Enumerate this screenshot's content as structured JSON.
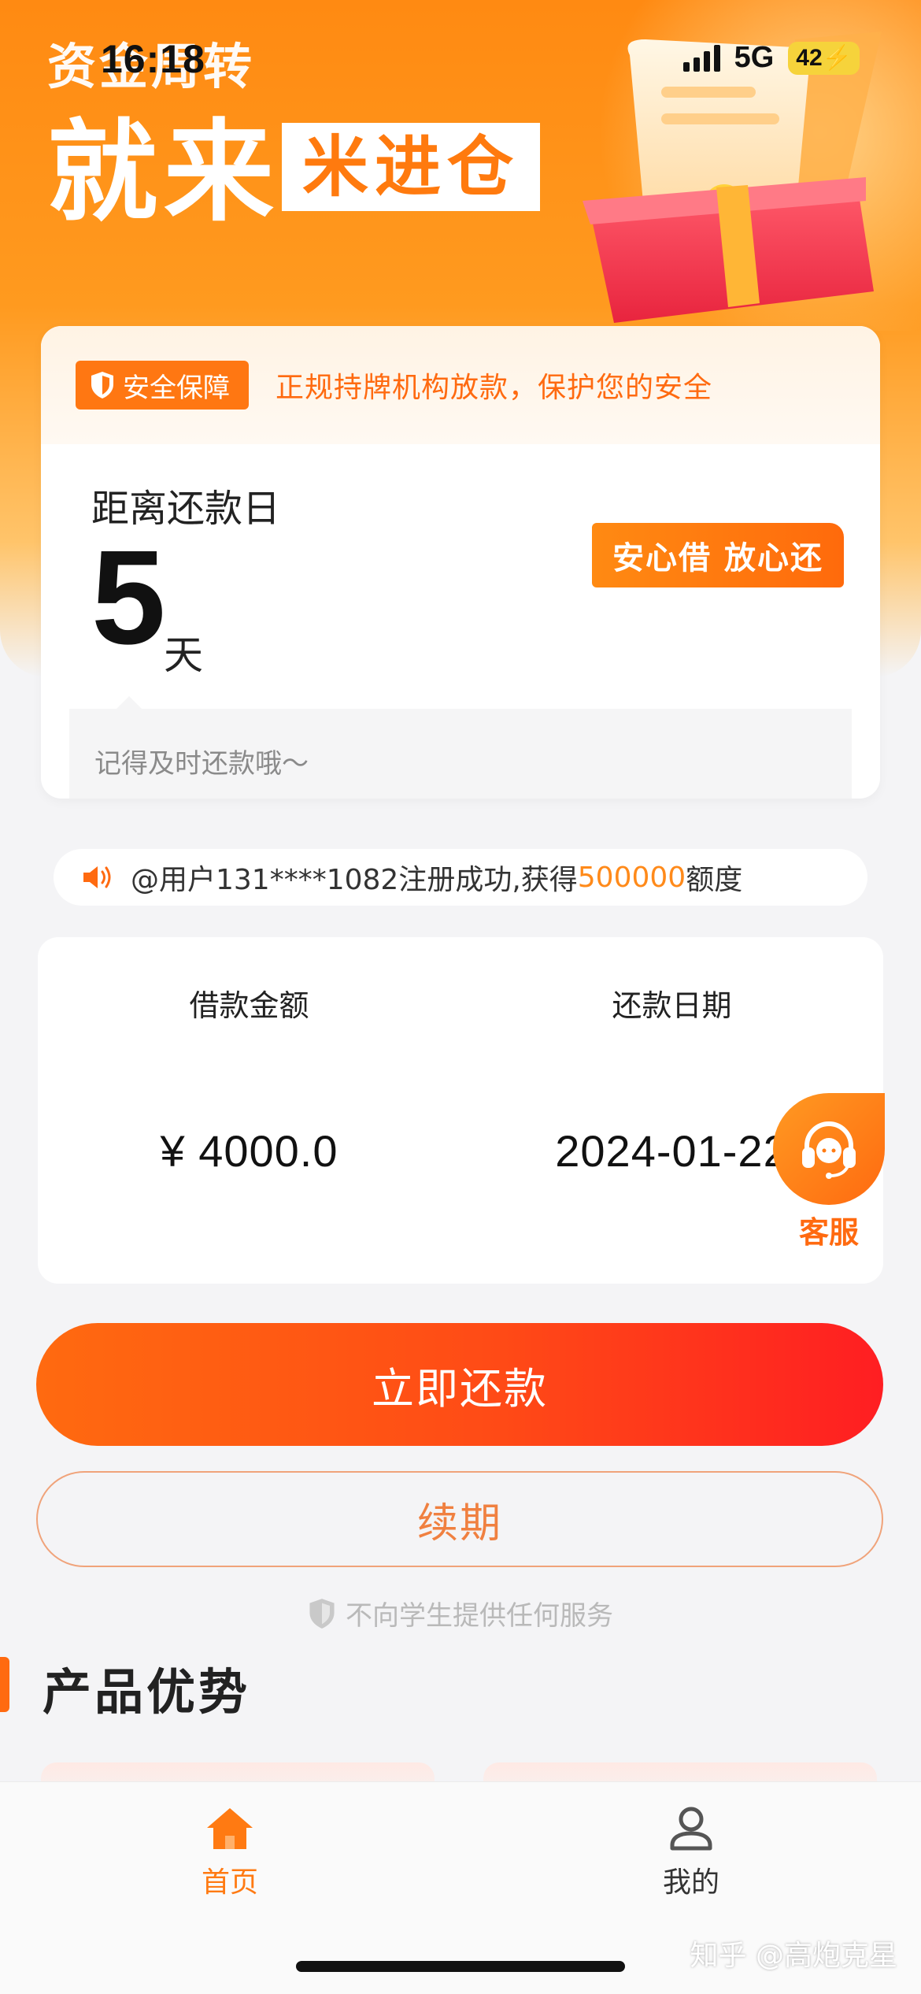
{
  "status_bar": {
    "time": "16:18",
    "network": "5G",
    "battery": "42"
  },
  "hero": {
    "subtitle": "资金周转",
    "title_big": "就来",
    "title_tag": "米进仓"
  },
  "safety": {
    "badge_label": "安全保障",
    "text": "正规持牌机构放款，保护您的安全"
  },
  "countdown": {
    "label": "距离还款日",
    "days": "5",
    "unit": "天",
    "slogan": "安心借 放心还",
    "reminder": "记得及时还款哦～"
  },
  "notice": {
    "prefix": "@用户131****1082注册成功,获得",
    "amount": "500000",
    "suffix": "额度"
  },
  "loan": {
    "amount_label": "借款金额",
    "amount_value": "¥ 4000.0",
    "date_label": "还款日期",
    "date_value": "2024-01-22"
  },
  "service": {
    "label": "客服"
  },
  "actions": {
    "repay_label": "立即还款",
    "renew_label": "续期"
  },
  "disclaimer": "不向学生提供任何服务",
  "section": {
    "title": "产品优势"
  },
  "tabbar": {
    "home_label": "首页",
    "mine_label": "我的"
  },
  "watermark": "知乎 @高炮克星",
  "colors": {
    "accent": "#ff7712",
    "accent_red": "#ff1e22",
    "highlight": "#ff8a1a",
    "battery": "#f6d33b"
  },
  "icons": {
    "safety_badge": "shield-icon",
    "notice": "speaker-icon",
    "service": "headset-icon",
    "disclaimer": "shield-icon",
    "tab_home": "home-icon",
    "tab_mine": "user-icon"
  }
}
